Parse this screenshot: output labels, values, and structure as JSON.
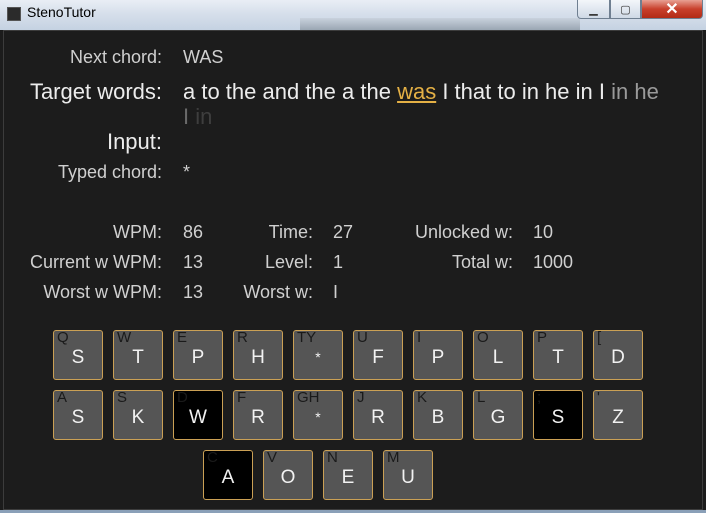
{
  "window": {
    "title": "StenoTutor"
  },
  "labels": {
    "next_chord": "Next chord:",
    "target_words": "Target words:",
    "input": "Input:",
    "typed_chord": "Typed chord:",
    "wpm": "WPM:",
    "current_w_wpm": "Current w WPM:",
    "worst_w_wpm": "Worst w WPM:",
    "time": "Time:",
    "level": "Level:",
    "worst_w": "Worst w:",
    "unlocked_w": "Unlocked w:",
    "total_w": "Total w:"
  },
  "values": {
    "next_chord": "WAS",
    "input": "",
    "typed_chord": "*",
    "wpm": "86",
    "current_w_wpm": "13",
    "worst_w_wpm": "13",
    "time": "27",
    "level": "1",
    "worst_w": "I",
    "unlocked_w": "10",
    "total_w": "1000"
  },
  "target": {
    "before": "a to the and the a the",
    "current": "was",
    "after": "I that to in he in I",
    "fade1": "in",
    "fade2": "he",
    "fade3": "I",
    "fade4": "in"
  },
  "colors": {
    "background": "#1c1c1c",
    "key": "#555555",
    "key_pressed": "#000000",
    "key_border": "#caa055",
    "current_word": "#e4b045"
  },
  "keys": {
    "row1": [
      {
        "hint": "Q",
        "label": "S"
      },
      {
        "hint": "W",
        "label": "T"
      },
      {
        "hint": "E",
        "label": "P"
      },
      {
        "hint": "R",
        "label": "H"
      },
      {
        "hint": "TY",
        "label": "*"
      },
      {
        "hint": "U",
        "label": "F"
      },
      {
        "hint": "I",
        "label": "P"
      },
      {
        "hint": "O",
        "label": "L"
      },
      {
        "hint": "P",
        "label": "T"
      },
      {
        "hint": "[",
        "label": "D"
      }
    ],
    "row2": [
      {
        "hint": "A",
        "label": "S"
      },
      {
        "hint": "S",
        "label": "K"
      },
      {
        "hint": "D",
        "label": "W"
      },
      {
        "hint": "F",
        "label": "R"
      },
      {
        "hint": "GH",
        "label": "*"
      },
      {
        "hint": "J",
        "label": "R"
      },
      {
        "hint": "K",
        "label": "B"
      },
      {
        "hint": "L",
        "label": "G"
      },
      {
        "hint": ";",
        "label": "S"
      },
      {
        "hint": "'",
        "label": "Z"
      }
    ],
    "row3": [
      {
        "hint": "C",
        "label": "A"
      },
      {
        "hint": "V",
        "label": "O"
      },
      {
        "hint": "N",
        "label": "E"
      },
      {
        "hint": "M",
        "label": "U"
      }
    ],
    "pressed": [
      "W",
      "right S",
      "A"
    ]
  }
}
